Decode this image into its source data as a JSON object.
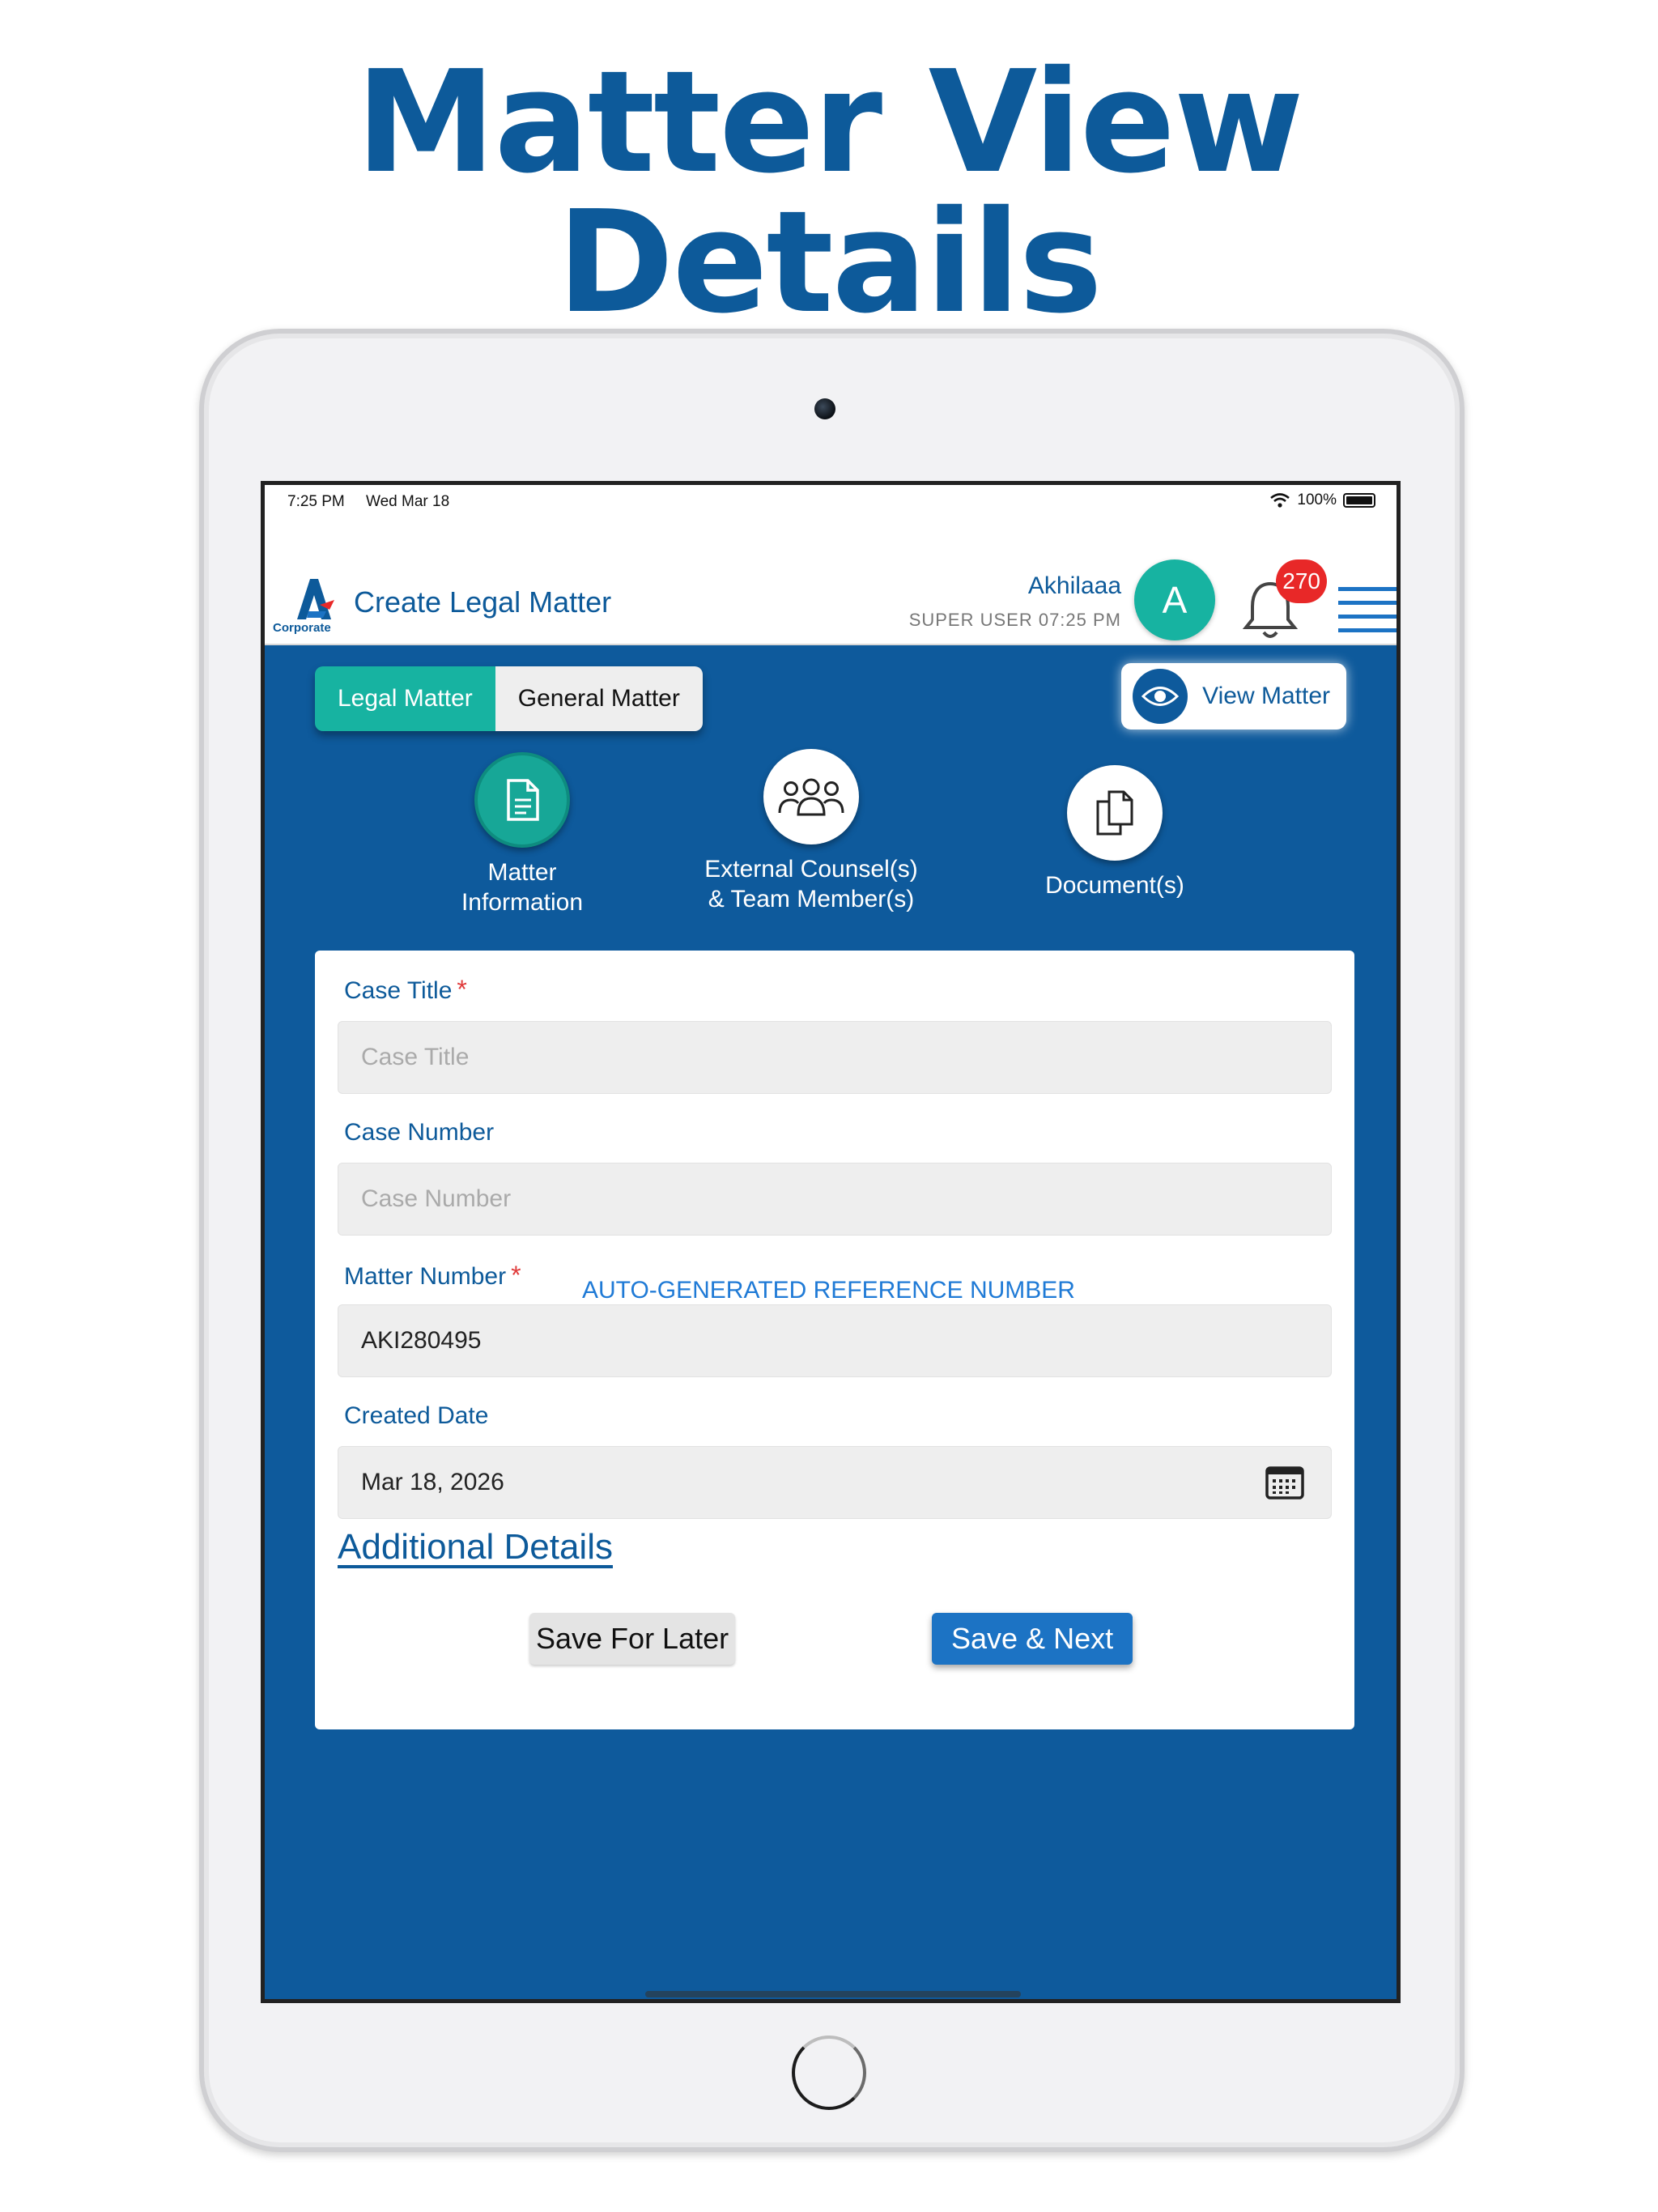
{
  "headline": {
    "line1": "Matter View",
    "line2": "Details"
  },
  "status_bar": {
    "time": "7:25 PM",
    "date": "Wed Mar 18",
    "battery": "100%"
  },
  "app_bar": {
    "logo_text": "Corporate",
    "title": "Create Legal Matter",
    "user_name": "Akhilaaa",
    "user_role": "SUPER USER  07:25 PM",
    "avatar_letter": "A",
    "notification_count": "270"
  },
  "segments": {
    "legal": "Legal Matter",
    "general": "General Matter",
    "selected": "legal"
  },
  "view_matter": {
    "label": "View Matter"
  },
  "steps": [
    {
      "line1": "Matter",
      "line2": "Information",
      "icon": "document-icon"
    },
    {
      "line1": "External Counsel(s)",
      "line2": "& Team Member(s)",
      "icon": "team-icon"
    },
    {
      "line1": "Document(s)",
      "line2": "",
      "icon": "documents-icon"
    }
  ],
  "form": {
    "case_title": {
      "label": "Case Title",
      "required": "*",
      "placeholder": "Case Title"
    },
    "case_number": {
      "label": "Case Number",
      "placeholder": "Case Number"
    },
    "matter_number": {
      "label": "Matter Number",
      "required": "*",
      "hint": "AUTO-GENERATED REFERENCE NUMBER",
      "value": "AKI280495"
    },
    "created_date": {
      "label": "Created Date",
      "value": "Mar 18, 2026"
    },
    "additional_details": "Additional Details",
    "save_later": "Save For Later",
    "save_next": "Save & Next"
  },
  "colors": {
    "brand_blue": "#0e5a9c",
    "teal": "#17b3a1",
    "button_blue": "#1c73c4",
    "badge_red": "#e82828"
  }
}
